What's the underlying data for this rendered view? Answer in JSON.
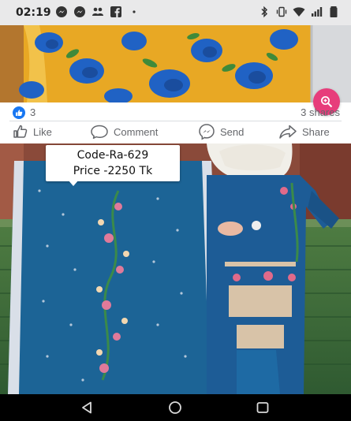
{
  "status_bar": {
    "time": "02:19",
    "left_icons": [
      "messenger-icon",
      "messenger-icon",
      "people-icon",
      "facebook-icon",
      "more-dots-icon"
    ],
    "right_icons": [
      "bluetooth-icon",
      "vibrate-icon",
      "wifi-icon",
      "signal-icon",
      "battery-icon"
    ]
  },
  "post_top": {
    "reaction_count": "3",
    "shares": "3 shares"
  },
  "actions": {
    "like": "Like",
    "comment": "Comment",
    "send": "Send",
    "share": "Share"
  },
  "post_main": {
    "tag_line1": "Code-Ra-629",
    "tag_line2": "Price -2250 Tk"
  },
  "nav": {
    "buttons": [
      "back-icon",
      "home-icon",
      "recents-icon"
    ]
  },
  "colors": {
    "facebook_blue": "#1877f2",
    "zoom_pink": "#e73d7b",
    "fabric_yellow": "#e3a623",
    "fabric_blue": "#1c5f8f"
  }
}
